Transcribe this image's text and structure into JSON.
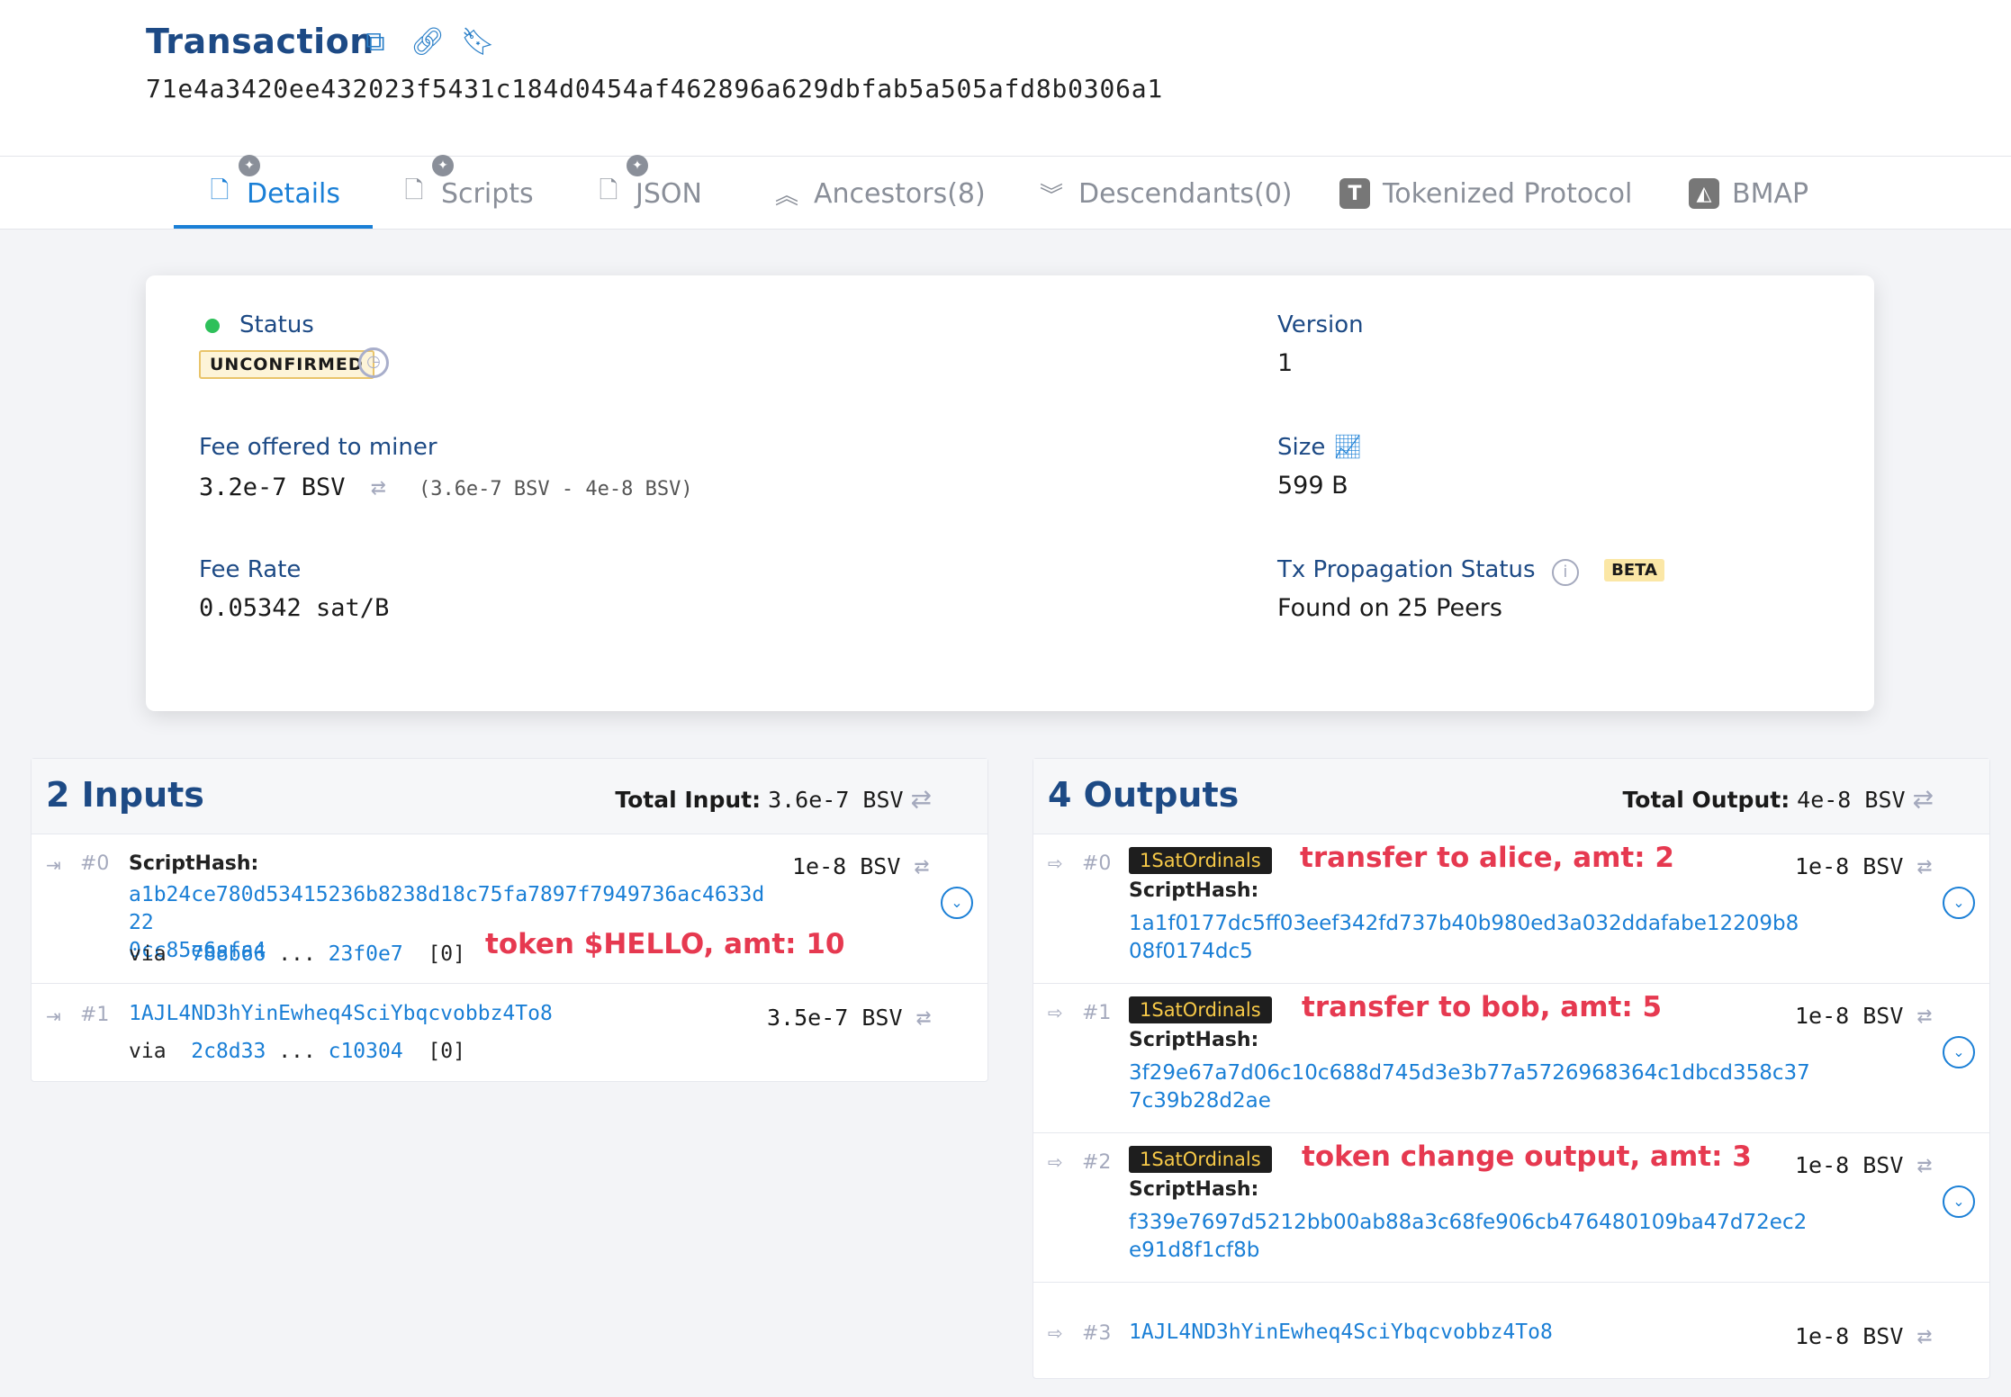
{
  "header": {
    "title": "Transaction",
    "txid": "71e4a3420ee432023f5431c184d0454af462896a629dbfab5a505afd8b0306a1",
    "icons": [
      "copy-icon",
      "link-icon",
      "bookmark-icon"
    ]
  },
  "tabs": [
    {
      "label": "Details",
      "icon": "bitcoin-doc-icon",
      "pinned": true,
      "active": true
    },
    {
      "label": "Scripts",
      "icon": "code-doc-icon",
      "pinned": true
    },
    {
      "label": "JSON",
      "icon": "json-doc-icon",
      "pinned": true
    },
    {
      "label": "Ancestors(8)",
      "icon": "double-chevron-up-icon"
    },
    {
      "label": "Descendants(0)",
      "icon": "double-chevron-down-icon"
    },
    {
      "label": "Tokenized Protocol",
      "icon": "tokenized-t-icon"
    },
    {
      "label": "BMAP",
      "icon": "bmap-icon"
    }
  ],
  "details": {
    "status_label": "Status",
    "status_badge": "UNCONFIRMED",
    "status_color": "#2ec05a",
    "version_label": "Version",
    "version_value": "1",
    "fee_label": "Fee offered to miner",
    "fee_value": "3.2e-7 BSV",
    "fee_breakdown": "(3.6e-7 BSV - 4e-8 BSV)",
    "size_label": "Size",
    "size_value": "599 B",
    "feerate_label": "Fee Rate",
    "feerate_value": "0.05342 sat/B",
    "propagation_label": "Tx Propagation Status",
    "propagation_badge": "BETA",
    "propagation_value": "Found on 25 Peers"
  },
  "inputs": {
    "title": "2 Inputs",
    "total_label": "Total Input:",
    "total_value": "3.6e-7 BSV",
    "rows": [
      {
        "index": "#0",
        "script_label": "ScriptHash:",
        "hash_line1": "a1b24ce780d53415236b8238d18c75fa7897f7949736ac4633d22",
        "hash_line2": "0cc85e6afa4",
        "amount": "1e-8 BSV",
        "via_label": "via",
        "via_start": "788b66",
        "via_sep": "...",
        "via_end": "23f0e7",
        "via_index": "[0]",
        "annotation": "token $HELLO, amt: 10"
      },
      {
        "index": "#1",
        "address": "1AJL4ND3hYinEwheq4SciYbqcvobbz4To8",
        "amount": "3.5e-7 BSV",
        "via_label": "via",
        "via_start": "2c8d33",
        "via_sep": "...",
        "via_end": "c10304",
        "via_index": "[0]"
      }
    ]
  },
  "outputs": {
    "title": "4 Outputs",
    "total_label": "Total Output:",
    "total_value": "4e-8 BSV",
    "rows": [
      {
        "index": "#0",
        "badge": "1SatOrdinals",
        "annotation": "transfer to alice, amt: 2",
        "script_label": "ScriptHash:",
        "hash_line1": "1a1f0177dc5ff03eef342fd737b40b980ed3a032ddafabe12209b8",
        "hash_line2": "08f0174dc5",
        "amount": "1e-8 BSV"
      },
      {
        "index": "#1",
        "badge": "1SatOrdinals",
        "annotation": "transfer to bob, amt: 5",
        "script_label": "ScriptHash:",
        "hash_line1": "3f29e67a7d06c10c688d745d3e3b77a5726968364c1dbcd358c37",
        "hash_line2": "7c39b28d2ae",
        "amount": "1e-8 BSV"
      },
      {
        "index": "#2",
        "badge": "1SatOrdinals",
        "annotation": "token change output, amt: 3",
        "script_label": "ScriptHash:",
        "hash_line1": "f339e7697d5212bb00ab88a3c68fe906cb476480109ba47d72ec2",
        "hash_line2": "e91d8f1cf8b",
        "amount": "1e-8 BSV"
      },
      {
        "index": "#3",
        "address": "1AJL4ND3hYinEwheq4SciYbqcvobbz4To8",
        "amount": "1e-8 BSV"
      }
    ]
  },
  "colors": {
    "accent": "#1a7fd6",
    "title": "#1d4a85",
    "annotation": "#e63950",
    "ordinals_badge_bg": "#1e1e1e",
    "ordinals_badge_text": "#f7c948"
  }
}
